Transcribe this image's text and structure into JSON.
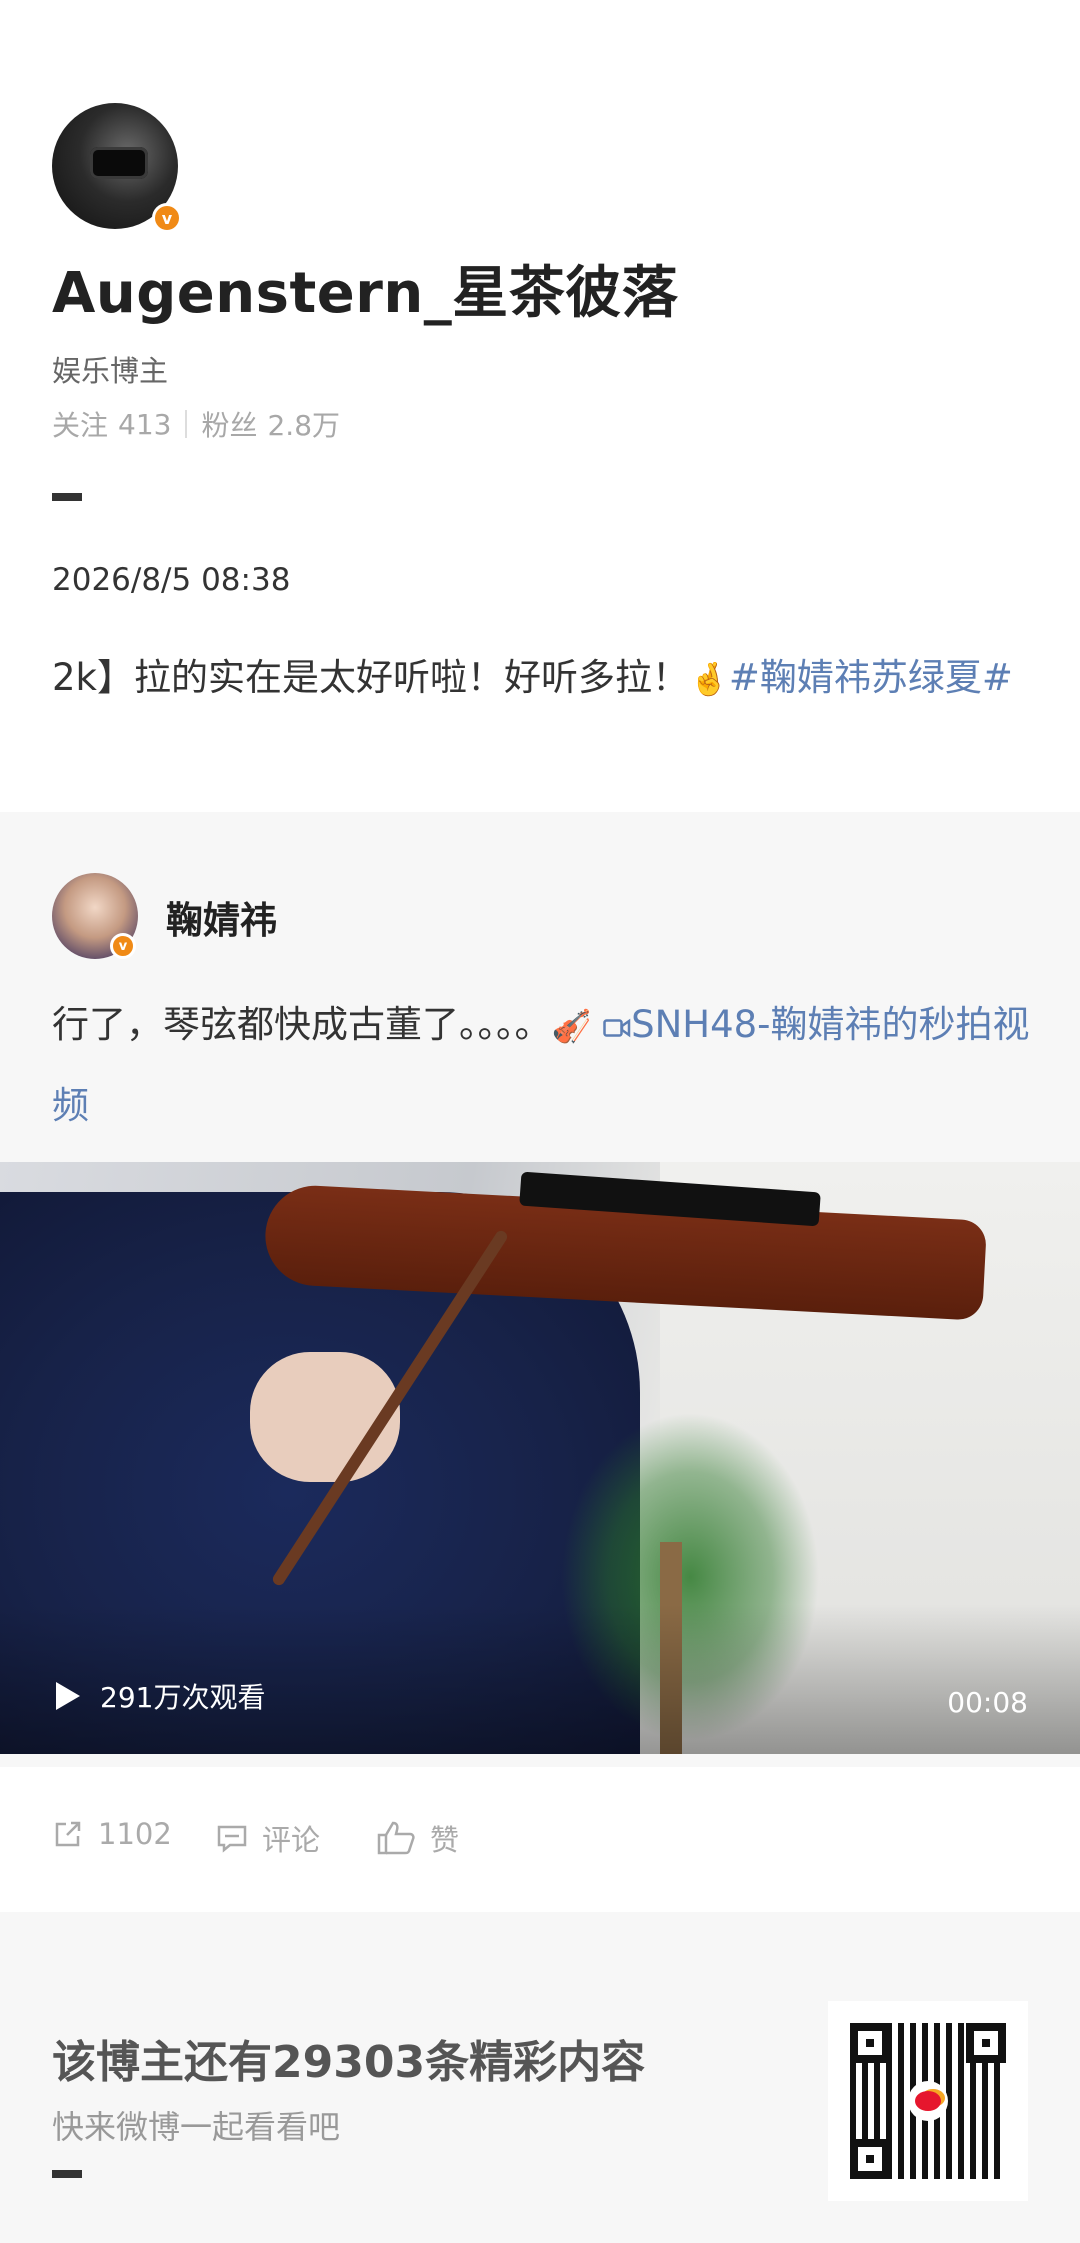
{
  "author": {
    "name": "Augenstern_星茶彼落",
    "role": "娱乐博主",
    "following_label": "关注",
    "following_count": "413",
    "followers_label": "粉丝",
    "followers_count": "2.8万",
    "avatar_icon": "avatar-dark-photo",
    "verified_icon": "verified-v-badge",
    "verified_glyph": "v"
  },
  "post": {
    "date": "2026/8/5 08:38",
    "text": "2k】拉的实在是太好听啦！好听多拉！",
    "emoji": "🤞",
    "hashtag": "#鞠婧祎苏绿夏#"
  },
  "repost": {
    "name": "鞠婧祎",
    "text": "行了，琴弦都快成古董了。。。。",
    "emoji": "🎻",
    "video_link_icon": "video-camera-icon",
    "video_link": "SNH48-鞠婧祎的秒拍视频"
  },
  "video": {
    "views": "291万次观看",
    "duration": "00:08",
    "play_icon": "play-icon"
  },
  "actions": {
    "share_count": "1102",
    "comment_label": "评论",
    "like_label": "赞"
  },
  "promo": {
    "title": "该博主还有29303条精彩内容",
    "subtitle": "快来微博一起看看吧",
    "qr_icon": "qr-code"
  },
  "colors": {
    "link": "#5d7fb4",
    "verified": "#f08a16",
    "card_bg": "#f7f7f7"
  }
}
